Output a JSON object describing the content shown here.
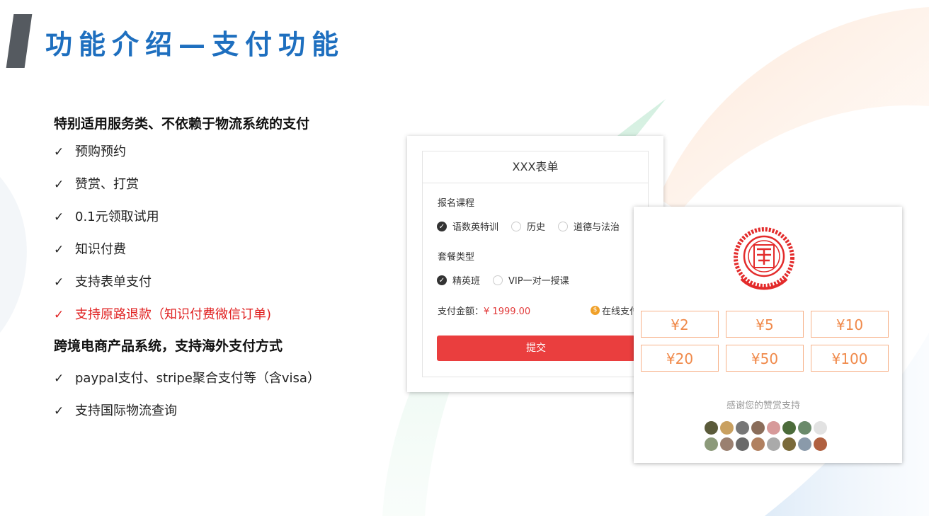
{
  "page": {
    "title": "功能介绍—支付功能"
  },
  "features": {
    "section1_heading": "特别适用服务类、不依赖于物流系统的支付",
    "section1_items": [
      {
        "check": "✓",
        "text": "预购预约"
      },
      {
        "check": "✓",
        "text": "赞赏、打赏"
      },
      {
        "check": "✓",
        "text": "0.1元领取试用"
      },
      {
        "check": "✓",
        "text": "知识付费"
      },
      {
        "check": "✓",
        "text": "支持表单支付"
      },
      {
        "check": "✓",
        "text": "支持原路退款（知识付费微信订单)"
      }
    ],
    "section2_heading": "跨境电商产品系统，支持海外支付方式",
    "section2_items": [
      {
        "check": "✓",
        "text": "paypal支付、stripe聚合支付等（含visa）"
      },
      {
        "check": "✓",
        "text": "支持国际物流查询"
      }
    ]
  },
  "form": {
    "title": "XXX表单",
    "course_label": "报名课程",
    "course_options": [
      "语数英特训",
      "历史",
      "道德与法治"
    ],
    "course_selected": "语数英特训",
    "package_label": "套餐类型",
    "package_options": [
      "精英班",
      "VIP一对一授课"
    ],
    "package_selected": "精英班",
    "amount_label": "支付金额：",
    "amount_value": "¥ 1999.00",
    "pay_method": "在线支付",
    "submit_label": "提交"
  },
  "reward": {
    "amounts": [
      "¥2",
      "¥5",
      "¥10",
      "¥20",
      "¥50",
      "¥100"
    ],
    "thanks_text": "感谢您的赞赏支持"
  },
  "colors": {
    "title_blue": "#1e6fbf",
    "accent_red": "#e02020",
    "submit_red": "#ea3e3e",
    "amount_orange": "#f08a4b"
  }
}
